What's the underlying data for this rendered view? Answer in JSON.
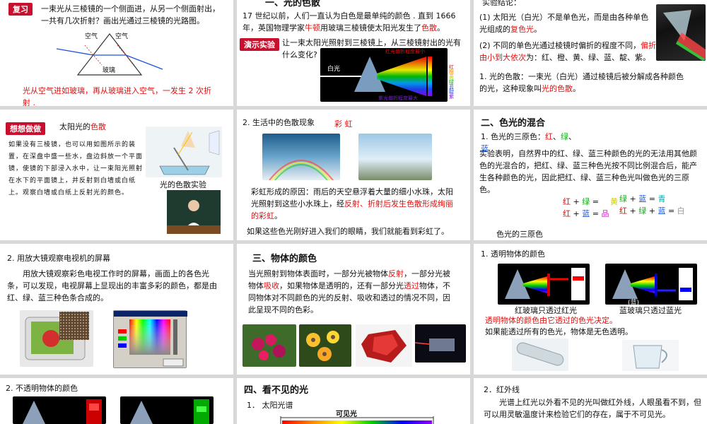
{
  "s1": {
    "tag": "复习",
    "q": "一束光从三棱镜的一个侧面进，从另一个侧面射出，一共有几次折射？画出光通过三棱镜的光路图。",
    "air_l": "空气",
    "air_r": "空气",
    "glass": "玻璃",
    "ans": "光从空气进如玻璃，再从玻璃进入空气，一发生 2 次折射 ."
  },
  "s2": {
    "title": "一、光的色散",
    "p1a": "17 世纪以前，人们一直认为白色是最单纯的颜色 . 直到 1666 年，英国物理学家",
    "newton": "牛顿",
    "p1b": "用玻璃三棱镜使太阳光发生了",
    "disp": "色散",
    "p1c": "。",
    "tag": "演示实验",
    "q": "让一束太阳光照射到三棱镜上，从三棱镜射出的光有什么变化?",
    "red_lbl": "红光偏折程度最小",
    "violet_lbl": "紫光偏折程度最大",
    "white": "白光",
    "spec": [
      "红",
      "橙",
      "黄",
      "绿",
      "蓝",
      "靛",
      "紫"
    ]
  },
  "s3": {
    "h": "实验结论：",
    "c1a": "(1) 太阳光（白光）不是单色光，而是由各种单色光组成的",
    "c1b": "复色光",
    "c1c": "。",
    "c2a": "(2) 不同的单色光通过棱镜时偏折的程度不同，",
    "c2b": "偏折由小到大依次",
    "c2c": "为：红、橙、黄、绿、蓝、靛、紫。",
    "c3a": "1. 光的色散：一束光（白光）通过棱镜后被分解成各种颜色的光，这种现象叫",
    "c3b": "光的色散",
    "c3c": "。"
  },
  "s4": {
    "tag": "想想做做",
    "title_a": "太阳光的",
    "title_b": "色散",
    "body": "如果没有三棱镜，也可以用如图所示的装置，在深盘中盛一些水，盘边斜放一个平面镜，使镜的下部浸入水中，让一束阳光照射在水下的平面镜上，并反射到白墙或白纸上。观察白墙或白纸上反射光的颜色。",
    "cap": "光的色散实验"
  },
  "s5": {
    "h": "2. 生活中的色散现象",
    "rainbow": "彩 虹",
    "p1a": "彩虹形成的原因：雨后的天空悬浮着大量的细小水珠，太阳光照射到这些小水珠上，经",
    "p1b": "反射、折射后发生色散形成绚丽的彩虹",
    "p1c": "。",
    "p2": "如果这些色光刚好进入我们的眼睛，我们就能看到彩虹了。"
  },
  "s6": {
    "title": "二、色光的混合",
    "p1": "1. 色光的三原色：",
    "r": "红",
    "g": "绿",
    "b": "蓝",
    "sep": "、",
    "p2": "实验表明，自然界中的红、绿、蓝三种颜色的光的无法用其他颜色的光混合的，把红、绿、蓝三种色光按不同比例混合后，能产生各种颜色的光，因此把红、绿、蓝三种色光叫做色光的三原色。",
    "eq1": "+",
    "eq_eq": "=",
    "yellow": "黄",
    "cyan": "青",
    "magenta": "品",
    "white": "白",
    "cap": "色光的三原色"
  },
  "s7": {
    "h": "2. 用放大镜观察电视机的屏幕",
    "p": "用放大镜观察彩色电视工作时的屏幕，画面上的各色光条，可以发现，电视屏幕上显现出的丰富多彩的颜色，都是由红、绿、蓝三种色条合成的。"
  },
  "s8": {
    "title": "三、物体的颜色",
    "pa": "当光照射到物体表面时，一部分光被物体",
    "pb": "反射",
    "pc": "，一部分光被物体",
    "pd": "吸收",
    "pe": "，如果物体是透明的，还有一部分光",
    "pf": "透过",
    "pg": "物体，不同物体对不同颜色的光的反射、吸收和透过的情况不同，因此呈现不同的色彩。"
  },
  "s9": {
    "h": "1. 透明物体的颜色",
    "cap1": "红玻璃只透过红光",
    "cap2": "蓝玻璃只透过蓝光",
    "small": "(蓝)",
    "rule": "透明物体的颜色由它透过的色光决定。",
    "p2": "如果能透过所有的色光，物体是无色透明。"
  },
  "s10": {
    "h": "2. 不透明物体的颜色"
  },
  "s11": {
    "title": "四、看不见的光",
    "p": "1．  太阳光谱",
    "vis": "可见光"
  },
  "s12": {
    "h": "2．红外线",
    "p": "光谱上红光以外看不见的光叫做红外线，人眼虽看不到，但可以用灵敏温度计来检验它们的存在，属于不可见光。"
  }
}
